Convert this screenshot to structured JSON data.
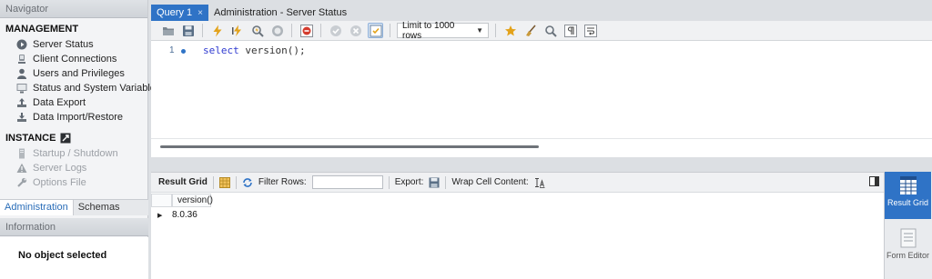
{
  "navigator": {
    "title": "Navigator",
    "management": {
      "title": "MANAGEMENT",
      "items": [
        {
          "label": "Server Status"
        },
        {
          "label": "Client Connections"
        },
        {
          "label": "Users and Privileges"
        },
        {
          "label": "Status and System Variables"
        },
        {
          "label": "Data Export"
        },
        {
          "label": "Data Import/Restore"
        }
      ]
    },
    "instance": {
      "title": "INSTANCE",
      "items": [
        {
          "label": "Startup / Shutdown"
        },
        {
          "label": "Server Logs"
        },
        {
          "label": "Options File"
        }
      ]
    },
    "tabs": [
      "Administration",
      "Schemas"
    ],
    "info_title": "Information",
    "info_body": "No object selected"
  },
  "tabs": [
    {
      "label": "Query 1",
      "close": "×"
    },
    {
      "label": "Administration - Server Status"
    }
  ],
  "toolbar": {
    "limit": "Limit to 1000 rows"
  },
  "editor": {
    "line_number": "1",
    "code_keyword": "select",
    "code_rest": " version();"
  },
  "result_toolbar": {
    "result_grid": "Result Grid",
    "filter_rows": "Filter Rows:",
    "filter_value": "",
    "export": "Export:",
    "wrap": "Wrap Cell Content:"
  },
  "grid": {
    "columns": [
      "version()"
    ],
    "rows": [
      [
        "8.0.36"
      ]
    ]
  },
  "side_panel": {
    "result_grid": "Result Grid",
    "form_editor": "Form Editor"
  },
  "colors": {
    "accent": "#2f73c6",
    "keyword": "#2f3ad0"
  }
}
